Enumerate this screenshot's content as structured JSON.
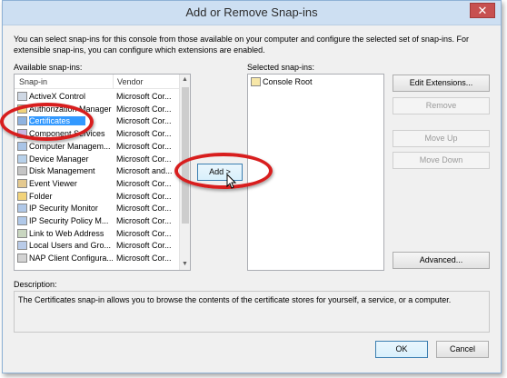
{
  "window": {
    "title": "Add or Remove Snap-ins",
    "close_glyph": "✕"
  },
  "intro_text": "You can select snap-ins for this console from those available on your computer and configure the selected set of snap-ins. For extensible snap-ins, you can configure which extensions are enabled.",
  "available": {
    "label": "Available snap-ins:",
    "columns": [
      "Snap-in",
      "Vendor"
    ],
    "items": [
      {
        "name": "ActiveX Control",
        "vendor": "Microsoft Cor...",
        "icon": "activex-icon"
      },
      {
        "name": "Authorization Manager",
        "vendor": "Microsoft Cor...",
        "icon": "authorization-icon"
      },
      {
        "name": "Certificates",
        "vendor": "Microsoft Cor...",
        "icon": "certificate-icon",
        "selected": true
      },
      {
        "name": "Component Services",
        "vendor": "Microsoft Cor...",
        "icon": "component-icon"
      },
      {
        "name": "Computer Managem...",
        "vendor": "Microsoft Cor...",
        "icon": "computer-icon"
      },
      {
        "name": "Device Manager",
        "vendor": "Microsoft Cor...",
        "icon": "device-icon"
      },
      {
        "name": "Disk Management",
        "vendor": "Microsoft and...",
        "icon": "disk-icon"
      },
      {
        "name": "Event Viewer",
        "vendor": "Microsoft Cor...",
        "icon": "event-icon"
      },
      {
        "name": "Folder",
        "vendor": "Microsoft Cor...",
        "icon": "folder-icon"
      },
      {
        "name": "IP Security Monitor",
        "vendor": "Microsoft Cor...",
        "icon": "ipsec-monitor-icon"
      },
      {
        "name": "IP Security Policy M...",
        "vendor": "Microsoft Cor...",
        "icon": "ipsec-policy-icon"
      },
      {
        "name": "Link to Web Address",
        "vendor": "Microsoft Cor...",
        "icon": "link-icon"
      },
      {
        "name": "Local Users and Gro...",
        "vendor": "Microsoft Cor...",
        "icon": "users-icon"
      },
      {
        "name": "NAP Client Configura...",
        "vendor": "Microsoft Cor...",
        "icon": "nap-icon"
      }
    ]
  },
  "add_button": "Add >",
  "selected": {
    "label": "Selected snap-ins:",
    "items": [
      {
        "name": "Console Root",
        "icon": "console-root-icon"
      }
    ]
  },
  "buttons": {
    "edit_extensions": "Edit Extensions...",
    "remove": "Remove",
    "move_up": "Move Up",
    "move_down": "Move Down",
    "advanced": "Advanced...",
    "ok": "OK",
    "cancel": "Cancel"
  },
  "description": {
    "label": "Description:",
    "text": "The Certificates snap-in allows you to browse the contents of the certificate stores for yourself, a service, or a computer."
  },
  "scroll": {
    "up_glyph": "▲",
    "down_glyph": "▼"
  },
  "colors": {
    "selection": "#3399ff",
    "annotation": "#d81e1e"
  }
}
